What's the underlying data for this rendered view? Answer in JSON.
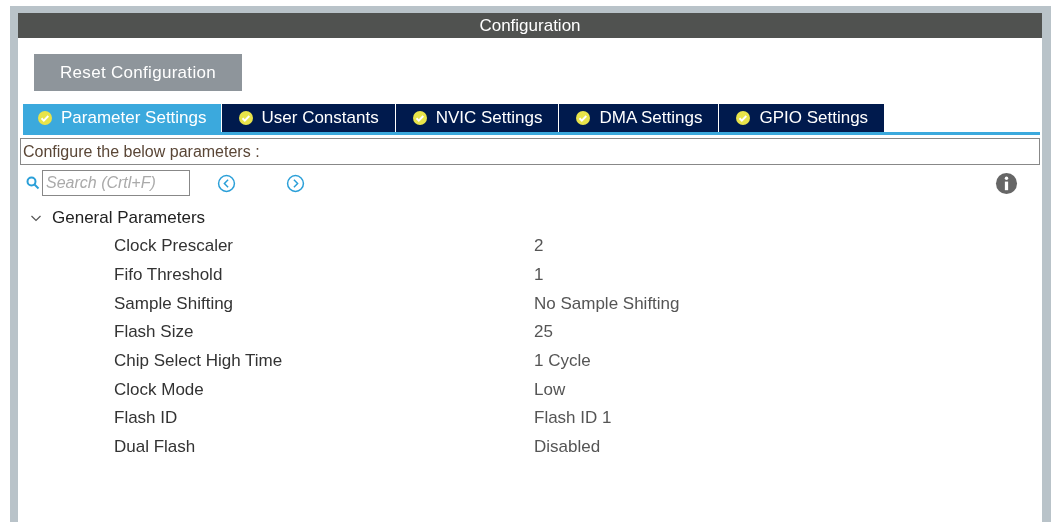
{
  "window": {
    "title": "Configuration"
  },
  "reset_button": "Reset Configuration",
  "tabs": [
    {
      "label": "Parameter Settings",
      "selected": true
    },
    {
      "label": "User Constants",
      "selected": false
    },
    {
      "label": "NVIC Settings",
      "selected": false
    },
    {
      "label": "DMA Settings",
      "selected": false
    },
    {
      "label": "GPIO Settings",
      "selected": false
    }
  ],
  "description": "Configure the below parameters :",
  "search": {
    "placeholder": "Search (Crtl+F)"
  },
  "group": {
    "label": "General Parameters",
    "expanded": true,
    "parameters": [
      {
        "name": "Clock Prescaler",
        "value": "2"
      },
      {
        "name": "Fifo Threshold",
        "value": "1"
      },
      {
        "name": "Sample Shifting",
        "value": "No Sample Shifting"
      },
      {
        "name": "Flash Size",
        "value": "25"
      },
      {
        "name": "Chip Select High Time",
        "value": "1 Cycle"
      },
      {
        "name": "Clock Mode",
        "value": "Low"
      },
      {
        "name": "Flash ID",
        "value": "Flash ID 1"
      },
      {
        "name": "Dual Flash",
        "value": "Disabled"
      }
    ]
  }
}
